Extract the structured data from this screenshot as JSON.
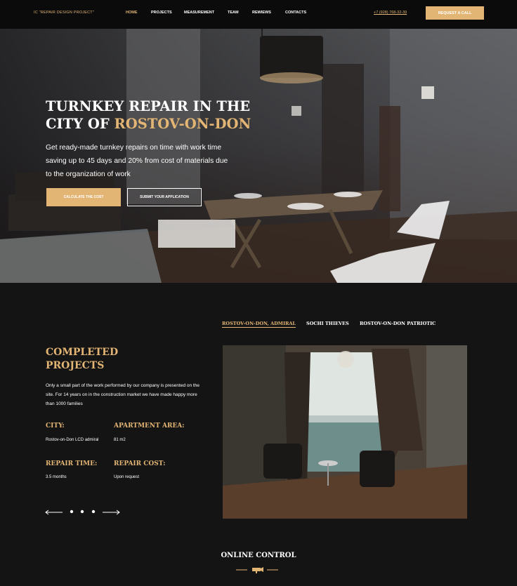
{
  "header": {
    "logo": "IC \"REPAIR DESIGN PROJECT\"",
    "nav": [
      "HOME",
      "PROJECTS",
      "MEASUREMENT",
      "TEAM",
      "REWIEWS",
      "CONTACTS"
    ],
    "phone": "+7 (928) 768-32-39",
    "request_button": "REQUEST A CALL"
  },
  "hero": {
    "title_line1": "TURNKEY REPAIR IN THE",
    "title_line2_prefix": "CITY OF",
    "title_line2_accent": "ROSTOV-ON-DON",
    "subtitle": "Get ready-made turnkey repairs on time with work time saving up to 45 days and 20% from cost of materials due to the organization of work",
    "calc_button": "CALCULATE THE COST",
    "submit_button": "SUBMIT YOUR APPLICATION"
  },
  "projects": {
    "tabs": [
      "ROSTOV-ON-DON, ADMIRAL",
      "SOCHI THIEVES",
      "ROSTOV-ON-DON PATRIOTIC"
    ],
    "title_line1": "COMPLETED",
    "title_line2": "PROJECTS",
    "description": "Only a small part of the work performed by our company is presented on the site. For 14 years on in the construction market we have made happy more than 1000 families",
    "city_label": "CITY:",
    "city_value": "Rostov-on-Don LCD admiral",
    "area_label": "APARTMENT AREA:",
    "area_value": "81 m2",
    "time_label": "REPAIR TIME:",
    "time_value": "3.5 months",
    "cost_label": "REPAIR COST:",
    "cost_value": "Upon request"
  },
  "online_control": {
    "title": "ONLINE CONTROL"
  },
  "colors": {
    "accent": "#e3b574",
    "background": "#141414",
    "header": "#0b0b0b"
  },
  "icons": [
    "arrow-left-icon",
    "arrow-right-icon",
    "camera-icon"
  ]
}
